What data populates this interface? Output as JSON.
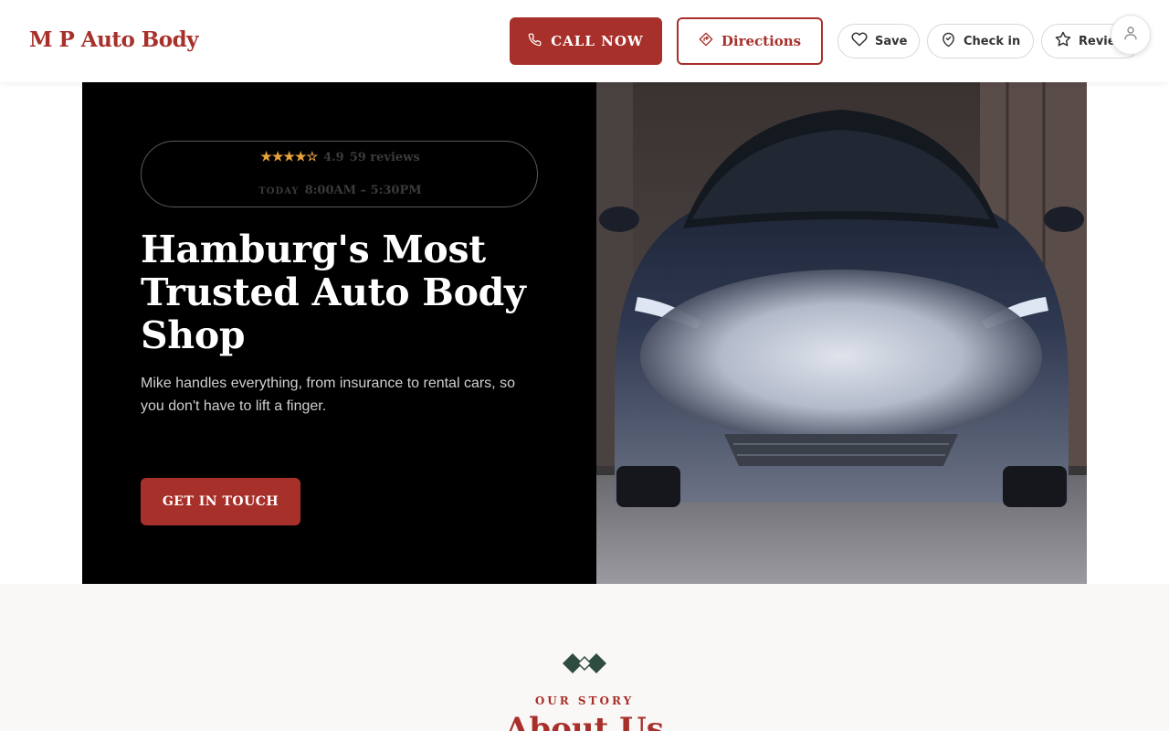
{
  "header": {
    "logo": "M P Auto Body",
    "call_label": "CALL NOW",
    "directions_label": "Directions",
    "save_label": "Save",
    "checkin_label": "Check in",
    "review_label": "Review"
  },
  "hero": {
    "stars": "★★★★☆",
    "rating": "4.9",
    "reviews": "59 reviews",
    "today_label": "TODAY",
    "hours": "8:00AM – 5:30PM",
    "title": "Hamburg's Most Trusted Auto Body Shop",
    "subtitle": "Mike handles everything, from insurance to rental cars, so you don't have to lift a finger.",
    "cta_label": "GET IN TOUCH"
  },
  "about": {
    "eyebrow": "OUR STORY",
    "title": "About Us"
  },
  "colors": {
    "brand": "#a8302b",
    "star": "#e8a33d",
    "hero_bg": "#000000",
    "diamond": "#2f4d3f"
  },
  "icons": [
    "phone-icon",
    "directions-icon",
    "heart-icon",
    "pin-icon",
    "star-icon",
    "user-icon",
    "diamond-ornament-icon"
  ]
}
